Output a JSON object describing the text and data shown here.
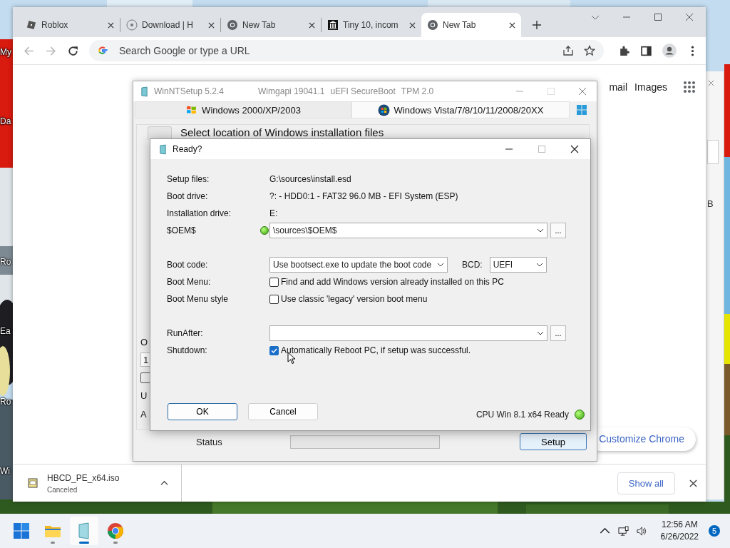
{
  "desktop": {
    "icon_labels": [
      "My",
      "Da",
      "Ro",
      "Ea",
      "Ro",
      "Wi"
    ]
  },
  "browser": {
    "tabs": [
      {
        "title": "Roblox",
        "kind": "roblox",
        "selected": false
      },
      {
        "title": "Download | H",
        "kind": "disc",
        "selected": false
      },
      {
        "title": "New Tab",
        "kind": "chrome",
        "selected": false
      },
      {
        "title": "Tiny 10, incom",
        "kind": "museum",
        "selected": false
      },
      {
        "title": "New Tab",
        "kind": "chrome",
        "selected": true
      }
    ],
    "omnibox": {
      "placeholder": "Search Google or type a URL"
    },
    "header_links": [
      "mail",
      "Images"
    ],
    "customize_button": "Customize Chrome",
    "download": {
      "filename": "HBCD_PE_x64.iso",
      "status": "Canceled"
    },
    "show_all": "Show all"
  },
  "back_window": {
    "text": "B"
  },
  "setup_window": {
    "title": "WinNTSetup 5.2.4",
    "info": [
      "Wimgapi 19041.1",
      "uEFI SecureBoot",
      "TPM 2.0"
    ],
    "tabs": [
      {
        "label": "Windows 2000/XP/2003",
        "kind": "xp",
        "selected": false
      },
      {
        "label": "Windows Vista/7/8/10/11/2008/20XX",
        "kind": "vista",
        "selected": true
      }
    ],
    "section_title": "Select location of Windows installation files",
    "cut_texts": [
      "O",
      "1",
      "U",
      "A"
    ],
    "cut_checkbox": {
      "checked": false
    },
    "status_label": "Status",
    "progress": {
      "level": 0
    },
    "setup_button": "Setup"
  },
  "dialog": {
    "title": "Ready?",
    "rows": [
      {
        "label": "Setup files:",
        "kind": "text",
        "value": "G:\\sources\\install.esd"
      },
      {
        "label": "Boot drive:",
        "kind": "text",
        "value": "?: - HDD0:1 -  FAT32 96.0 MB - EFI System (ESP)"
      },
      {
        "label": "Installation drive:",
        "kind": "text",
        "value": "E:"
      },
      {
        "label": "$OEM$",
        "kind": "combo",
        "value": "\\sources\\$OEM$",
        "led": true,
        "browse": "..."
      },
      {
        "label": "Boot code:",
        "kind": "bootcode",
        "value": "Use bootsect.exe to update the boot code",
        "bcd_label": "BCD:",
        "bcd_value": "UEFI"
      },
      {
        "label": "Boot Menu:",
        "kind": "check",
        "text": "Find and add Windows version already installed on this PC",
        "checked": false
      },
      {
        "label": "Boot Menu style",
        "kind": "check",
        "text": "Use classic 'legacy' version boot menu",
        "checked": false
      },
      {
        "label": "RunAfter:",
        "kind": "combo",
        "browse": "..."
      },
      {
        "label": "Shutdown:",
        "kind": "check",
        "text": "Automatically Reboot PC, if setup was successful.",
        "checked": true
      }
    ],
    "ok": "OK",
    "cancel": "Cancel",
    "status": "CPU Win 8.1 x64 Ready"
  },
  "taskbar": {
    "apps": [
      {
        "kind": "start",
        "selected": false
      },
      {
        "kind": "explorer",
        "selected": false
      },
      {
        "kind": "setup",
        "selected": true
      },
      {
        "kind": "chrome",
        "selected": false
      }
    ],
    "time": "12:56 AM",
    "date": "6/26/2022",
    "badge": "5"
  }
}
